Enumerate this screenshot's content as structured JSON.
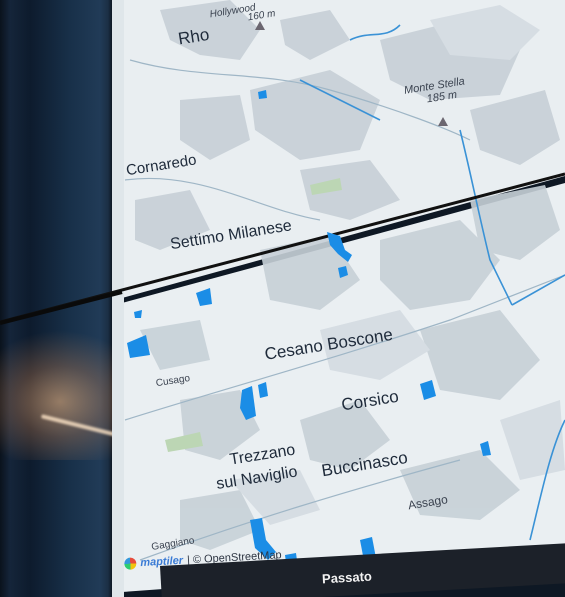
{
  "map": {
    "places": {
      "rho": "Rho",
      "cornaredo": "Cornaredo",
      "settimo": "Settimo Milanese",
      "cesano": "Cesano Boscone",
      "cusago": "Cusago",
      "corsico": "Corsico",
      "trezzano_1": "Trezzano",
      "trezzano_2": "sul Naviglio",
      "buccinasco": "Buccinasco",
      "assago": "Assago",
      "gaggiano": "Gaggiano"
    },
    "peaks": {
      "hollywood_name": "Hollywood",
      "hollywood_elev": "160 m",
      "monte_stella_name": "Monte Stella",
      "monte_stella_elev": "185 m"
    }
  },
  "attribution": {
    "brand": "maptiler",
    "credit": "| © OpenStreetMap"
  },
  "bottom_bar": {
    "label": "Passato"
  },
  "colors": {
    "map_background": "#e8eef1",
    "urban": "#c9d3da",
    "water": "#3a92d6",
    "highlight": "#1a8ee6",
    "panel_dark": "#1c2129"
  }
}
